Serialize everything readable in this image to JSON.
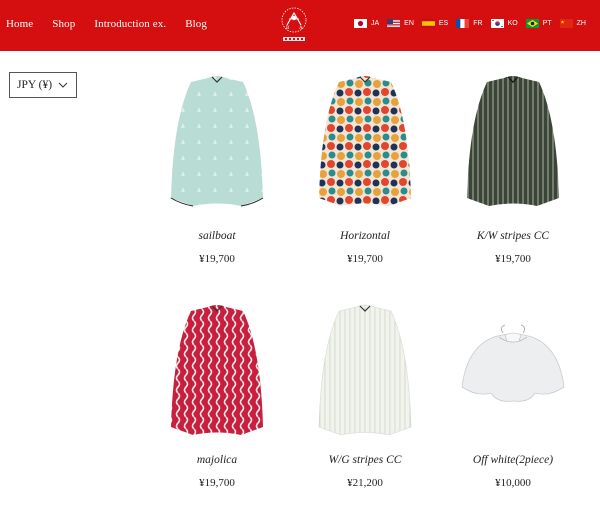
{
  "header": {
    "nav": [
      "Home",
      "Shop",
      "Introduction ex.",
      "Blog"
    ],
    "languages": [
      "JA",
      "EN",
      "ES",
      "FR",
      "KO",
      "PT",
      "ZH"
    ],
    "background": "#d50f0f"
  },
  "currency": {
    "selected": "JPY (¥)"
  },
  "products": [
    {
      "name": "sailboat",
      "price": "¥19,700"
    },
    {
      "name": "Horizontal",
      "price": "¥19,700"
    },
    {
      "name": "K/W stripes CC",
      "price": "¥19,700"
    },
    {
      "name": "majolica",
      "price": "¥19,700"
    },
    {
      "name": "W/G stripes CC",
      "price": "¥21,200"
    },
    {
      "name": "Off white(2piece)",
      "price": "¥10,000"
    }
  ]
}
